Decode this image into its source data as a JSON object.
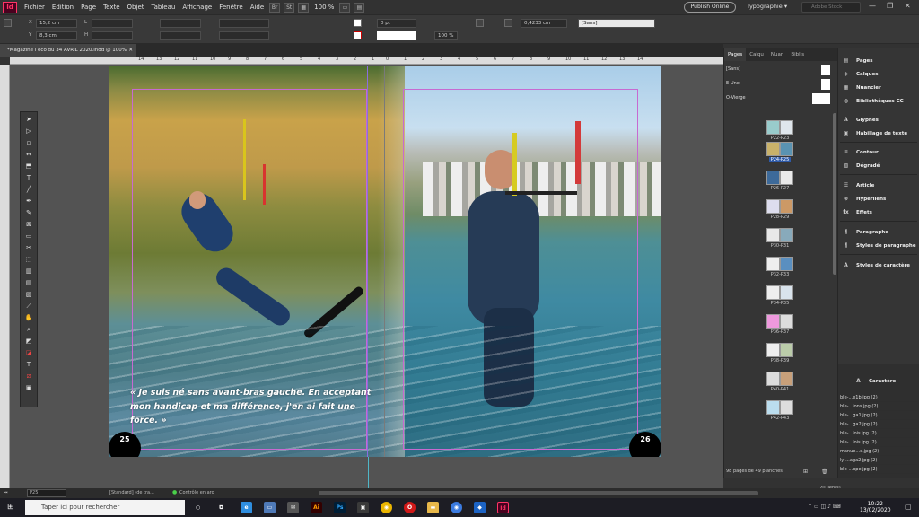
{
  "app": {
    "logo_text": "Id"
  },
  "menu": [
    "Fichier",
    "Edition",
    "Page",
    "Texte",
    "Objet",
    "Tableau",
    "Affichage",
    "Fenêtre",
    "Aide"
  ],
  "zoom": "100 %",
  "publish_button": "Publish Online",
  "workspace": "Typographie",
  "search_placeholder": "Adobe Stock",
  "control": {
    "x_label": "X",
    "x_value": "15,2 cm",
    "y_label": "Y",
    "y_value": "8,3 cm",
    "l_label": "L",
    "h_label": "H",
    "stroke_pt": "0 pt",
    "opacity": "100 %",
    "ref_value": "0,4233 cm",
    "style_value": "[Sans]"
  },
  "document_tab": "*Magazine l eco du 34 AVRIL 2020.indd @ 100%",
  "ruler_ticks": [
    "14",
    "13",
    "12",
    "11",
    "10",
    "9",
    "8",
    "7",
    "6",
    "5",
    "4",
    "3",
    "2",
    "1",
    "0",
    "1",
    "2",
    "3",
    "4",
    "5",
    "6",
    "7",
    "8",
    "9",
    "10",
    "11",
    "12",
    "13",
    "14"
  ],
  "quote": "« Je suis né sans avant-bras gauche. En acceptant mon handicap et ma différence, j'en ai fait une force. »",
  "page_left": "25",
  "page_right": "26",
  "pages_panel": {
    "tabs": [
      "Pages",
      "Calqu",
      "Nuan",
      "Biblis"
    ],
    "masters": [
      "[Sans]",
      "E-Une",
      "O-Vierge"
    ],
    "pages": [
      "P22-P23",
      "P24-P25",
      "P26-P27",
      "P28-P29",
      "P30-P31",
      "P32-P33",
      "P34-P35",
      "P36-P37",
      "P38-P39",
      "P40-P41",
      "P42-P43"
    ],
    "selected": "P24-P25",
    "status": "98 pages de 49 planches"
  },
  "right_panel": {
    "items": [
      {
        "icon": "pages-icon",
        "label": "Pages"
      },
      {
        "icon": "layers-icon",
        "label": "Calques"
      },
      {
        "icon": "swatches-icon",
        "label": "Nuancier"
      },
      {
        "icon": "cc-libraries-icon",
        "label": "Bibliothèques CC"
      },
      {
        "icon": "glyphs-icon",
        "label": "Glyphes"
      },
      {
        "icon": "text-wrap-icon",
        "label": "Habillage de texte"
      },
      {
        "icon": "stroke-icon",
        "label": "Contour"
      },
      {
        "icon": "gradient-icon",
        "label": "Dégradé"
      },
      {
        "icon": "article-icon",
        "label": "Article"
      },
      {
        "icon": "hyperlinks-icon",
        "label": "Hyperliens"
      },
      {
        "icon": "effects-icon",
        "label": "Effets"
      },
      {
        "icon": "paragraph-icon",
        "label": "Paragraphe"
      },
      {
        "icon": "paragraph-styles-icon",
        "label": "Styles de paragraphe"
      },
      {
        "icon": "character-styles-icon",
        "label": "Styles de caractère"
      }
    ],
    "character_label": "Caractère",
    "links": [
      "ble-...e1b.jpg (2)",
      "ble-...ions.jpg (2)",
      "ble-...ga1.jpg (2)",
      "ble-...ga2.jpg (2)",
      "ble-...lois.jpg (2)",
      "ble-...lois.jpg (2)",
      "manue...e.jpg (2)",
      "ly-...aga2.jpg (2)",
      "ble-...ope.jpg (2)"
    ],
    "links_count": "120 lien(s)"
  },
  "status_bar": {
    "page": "P25",
    "master": "[Standard] (de tra...",
    "preflight": "Contrôle en aro"
  },
  "taskbar": {
    "search_placeholder": "Taper ici pour rechercher",
    "time": "10:22",
    "date": "13/02/2020"
  }
}
